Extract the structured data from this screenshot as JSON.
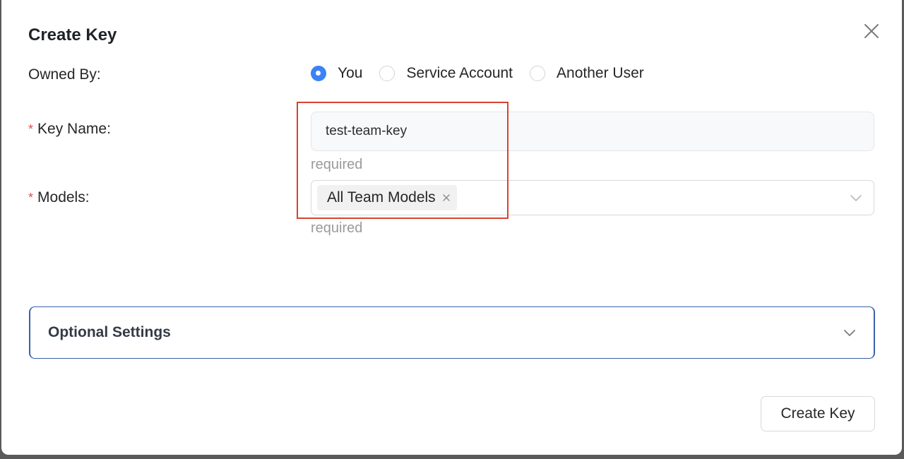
{
  "dialog": {
    "title": "Create Key"
  },
  "owned_by": {
    "label": "Owned By",
    "options": [
      {
        "label": "You",
        "checked": true
      },
      {
        "label": "Service Account",
        "checked": false
      },
      {
        "label": "Another User",
        "checked": false
      }
    ]
  },
  "key_name": {
    "required_mark": "*",
    "label": "Key Name",
    "value": "test-team-key",
    "help": "required"
  },
  "models": {
    "required_mark": "*",
    "label": "Models",
    "selected_tags": [
      "All Team Models"
    ],
    "help": "required"
  },
  "optional_settings": {
    "title": "Optional Settings"
  },
  "footer": {
    "create_label": "Create Key"
  },
  "colors": {
    "accent": "#3b82f6",
    "required": "#e34d4d",
    "highlight_box": "#d8432e",
    "collapse_border": "#3a62a8"
  },
  "icons": {
    "close": "close-icon",
    "dropdown": "chevron-down-icon",
    "tag_remove": "close-icon"
  }
}
